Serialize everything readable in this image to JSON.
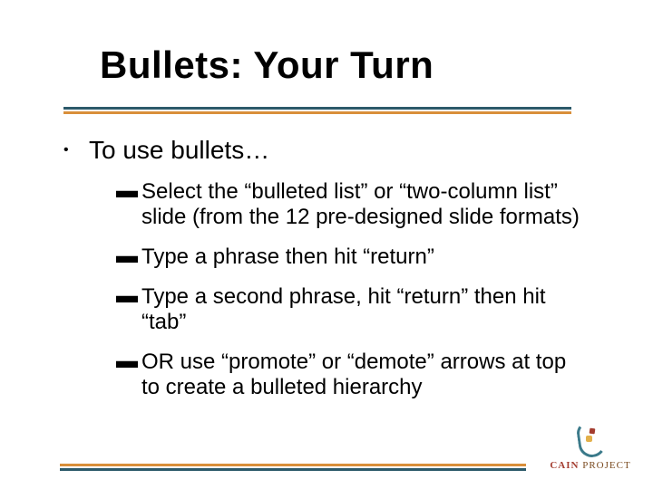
{
  "title": "Bullets: Your Turn",
  "body": {
    "level1_text": "To use bullets…",
    "level2": [
      "Select the “bulleted list” or “two-column list” slide (from the 12 pre-designed slide formats)",
      "Type a phrase then hit “return”",
      "Type a second phrase, hit “return” then hit “tab”",
      "OR use “promote” or “demote” arrows at top to create a bulleted hierarchy"
    ]
  },
  "logo": {
    "line1": "CAIN",
    "line2": "PROJECT"
  },
  "colors": {
    "teal": "#2c5a6a",
    "orange": "#d98f3a",
    "maroon": "#a33c2f"
  }
}
